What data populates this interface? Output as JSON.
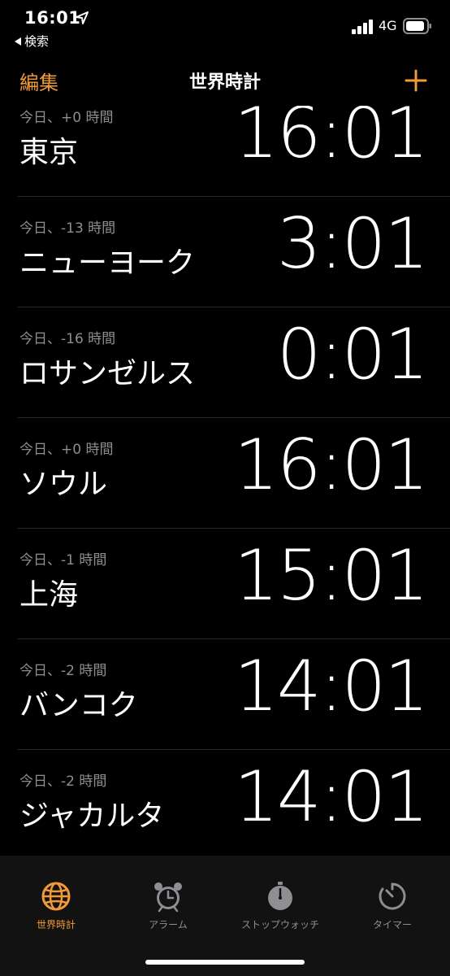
{
  "status_bar": {
    "time": "16:01",
    "back_app": "検索",
    "network": "4G"
  },
  "nav": {
    "edit_label": "編集",
    "title": "世界時計"
  },
  "clocks": [
    {
      "offset": "今日、+0 時間",
      "city": "東京",
      "time": "16:01"
    },
    {
      "offset": "今日、-13 時間",
      "city": "ニューヨーク",
      "time": "3:01"
    },
    {
      "offset": "今日、-16 時間",
      "city": "ロサンゼルス",
      "time": "0:01"
    },
    {
      "offset": "今日、+0 時間",
      "city": "ソウル",
      "time": "16:01"
    },
    {
      "offset": "今日、-1 時間",
      "city": "上海",
      "time": "15:01"
    },
    {
      "offset": "今日、-2 時間",
      "city": "バンコク",
      "time": "14:01"
    },
    {
      "offset": "今日、-2 時間",
      "city": "ジャカルタ",
      "time": "14:01"
    }
  ],
  "tabs": [
    {
      "label": "世界時計",
      "icon": "globe-icon",
      "active": true
    },
    {
      "label": "アラーム",
      "icon": "alarm-clock-icon",
      "active": false
    },
    {
      "label": "ストップウォッチ",
      "icon": "stopwatch-icon",
      "active": false
    },
    {
      "label": "タイマー",
      "icon": "timer-icon",
      "active": false
    }
  ],
  "colors": {
    "accent": "#f19a37",
    "background": "#000000",
    "secondary_text": "#8e8e93",
    "tab_bar": "#121212"
  }
}
